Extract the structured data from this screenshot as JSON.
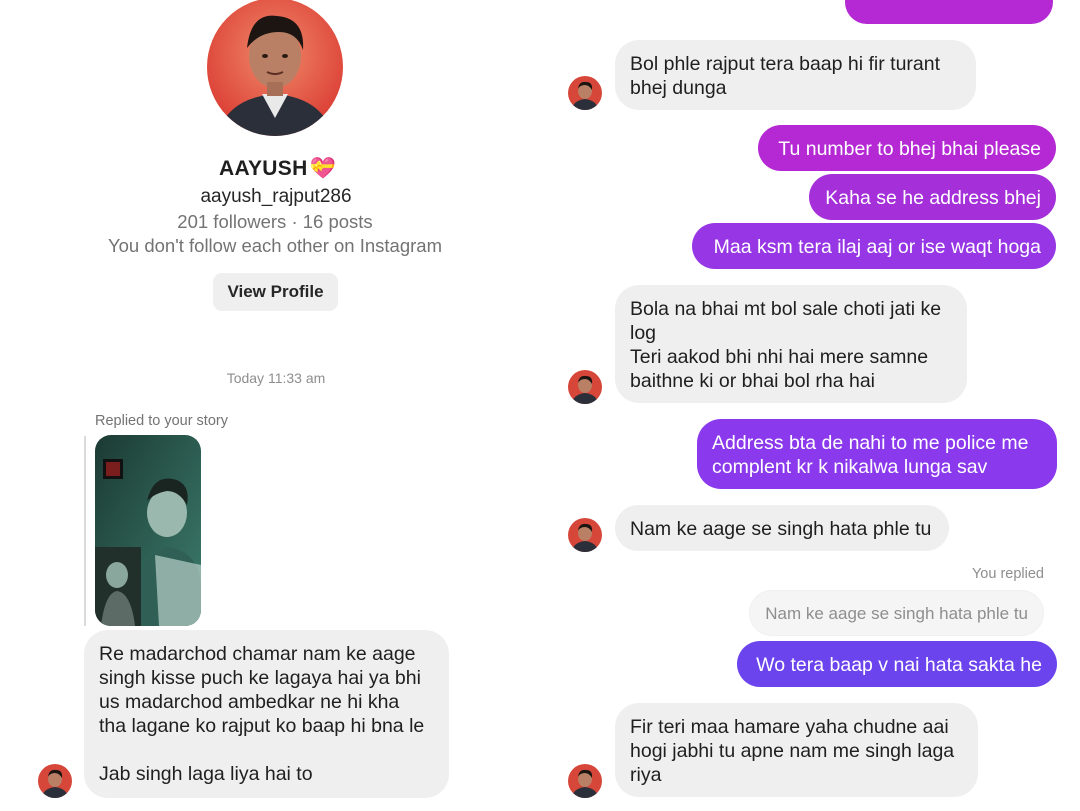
{
  "profile": {
    "name": "AAYUSH",
    "name_emoji": "💝",
    "username": "aayush_rajput286",
    "stats": "201 followers · 16 posts",
    "follow_status": "You don't follow each other on Instagram",
    "view_profile_label": "View Profile"
  },
  "thread": {
    "timestamp": "Today 11:33 am",
    "replied_to_story": "Replied to your story",
    "you_replied": "You replied"
  },
  "left_messages": [
    {
      "from": "them",
      "text": "Re madarchod chamar nam ke aage\nsingh kisse puch ke lagaya hai ya bhi\nus madarchod ambedkar ne hi kha\ntha lagane ko rajput ko baap hi bna le\n\nJab singh laga liya hai to"
    }
  ],
  "right_messages": [
    {
      "from": "them",
      "text": "Bol phle rajput tera baap hi fir turant\nbhej dunga"
    },
    {
      "from": "me",
      "text": "Tu number to bhej bhai please"
    },
    {
      "from": "me",
      "text": "Kaha se he address bhej"
    },
    {
      "from": "me",
      "text": "Maa ksm tera ilaj aaj or ise waqt hoga"
    },
    {
      "from": "them",
      "text": "Bola na bhai mt bol sale choti jati ke\nlog\nTeri aakod bhi nhi hai mere samne\nbaithne ki or bhai bol rha hai"
    },
    {
      "from": "me",
      "text": "Address bta de nahi to me police me\ncomplent kr k nikalwa lunga sav"
    },
    {
      "from": "them",
      "text": "Nam ke aage se singh hata phle tu"
    },
    {
      "from": "me",
      "quoted": "Nam ke aage se singh hata phle tu",
      "text": "Wo tera baap v nai hata sakta he"
    },
    {
      "from": "them",
      "text": "Fir teri maa hamare yaha chudne aai\nhogi jabhi tu apne nam me singh laga\nriya"
    }
  ],
  "colors": {
    "sent_magenta": "#b429d3",
    "sent_purple": "#8b39ec",
    "sent_violet": "#6c44ee",
    "received_bg": "#efefef",
    "muted_text": "#737373"
  },
  "icons": [
    "contact-avatar-icon",
    "story-thumbnail"
  ]
}
